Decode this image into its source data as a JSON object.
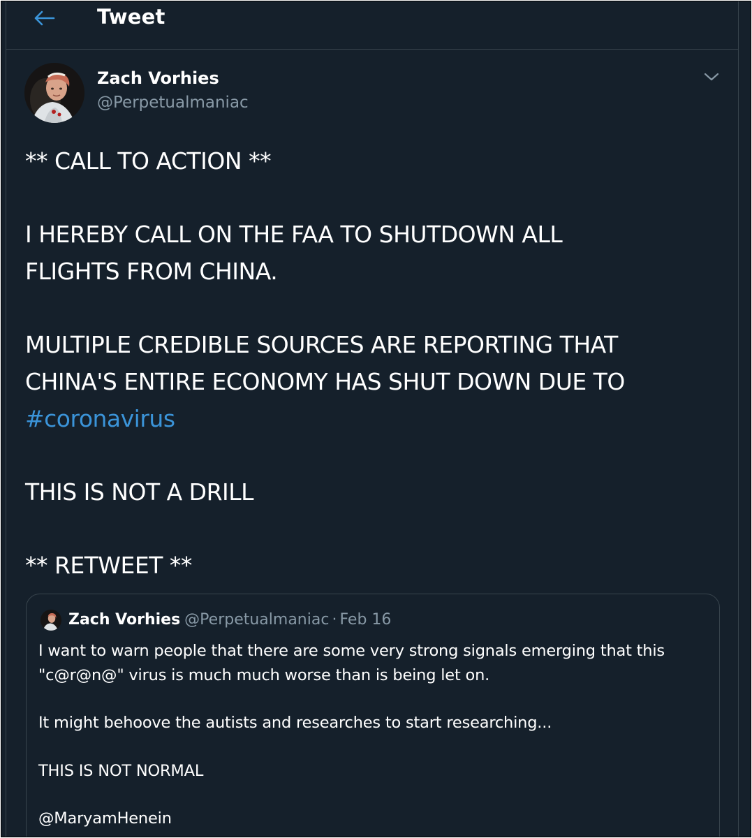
{
  "header": {
    "title": "Tweet"
  },
  "tweet": {
    "author_name": "Zach Vorhies",
    "author_handle": "@Perpetualmaniac",
    "lines": {
      "l1": "** CALL TO ACTION  **",
      "l2": "I HEREBY CALL ON THE FAA TO SHUTDOWN ALL",
      "l3": "FLIGHTS FROM CHINA.",
      "l4": "MULTIPLE CREDIBLE SOURCES ARE REPORTING THAT",
      "l5": "CHINA'S ENTIRE ECONOMY HAS SHUT DOWN DUE TO",
      "hashtag": "#coronavirus",
      "l6": "THIS IS NOT A DRILL",
      "l7": "** RETWEET **"
    }
  },
  "quoted_tweet": {
    "author_name": "Zach Vorhies",
    "author_handle": "@Perpetualmaniac",
    "separator": "·",
    "date": "Feb 16",
    "lines": {
      "l1": "I want to warn people that there are some very strong signals emerging that this",
      "l2": "\"c@r@n@\" virus is much much worse than is being let on.",
      "l3": "It might behoove the autists and researches to start researching...",
      "l4": "THIS IS NOT NORMAL",
      "mention": "@MaryamHenein"
    }
  },
  "colors": {
    "background": "#15202b",
    "text": "#ffffff",
    "secondary_text": "#8899a6",
    "accent": "#3b94d9",
    "border": "#38444d"
  },
  "icons": {
    "back": "arrow-left-icon",
    "more": "chevron-down-icon"
  }
}
